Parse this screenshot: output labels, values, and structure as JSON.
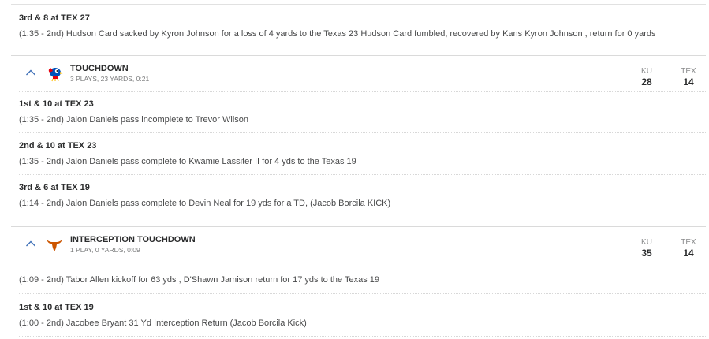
{
  "plays_prev": [
    {
      "down": "3rd & 8 at TEX 27",
      "desc": "(1:35 - 2nd) Hudson Card sacked by Kyron Johnson for a loss of 4 yards to the Texas 23 Hudson Card fumbled, recovered by Kans Kyron Johnson , return for 0 yards"
    }
  ],
  "drives": [
    {
      "title": "TOUCHDOWN",
      "summary": "3 PLAYS, 23 YARDS, 0:21",
      "team_logo": "kansas-jayhawk-logo",
      "home_abbr": "KU",
      "away_abbr": "TEX",
      "home_score": "28",
      "away_score": "14",
      "plays": [
        {
          "down": "1st & 10 at TEX 23",
          "desc": "(1:35 - 2nd) Jalon Daniels pass incomplete to Trevor Wilson"
        },
        {
          "down": "2nd & 10 at TEX 23",
          "desc": "(1:35 - 2nd) Jalon Daniels pass complete to Kwamie Lassiter II for 4 yds to the Texas 19"
        },
        {
          "down": "3rd & 6 at TEX 19",
          "desc": "(1:14 - 2nd) Jalon Daniels pass complete to Devin Neal for 19 yds for a TD, (Jacob Borcila KICK)"
        }
      ]
    },
    {
      "title": "INTERCEPTION TOUCHDOWN",
      "summary": "1 PLAY, 0 YARDS, 0:09",
      "team_logo": "texas-longhorn-logo",
      "home_abbr": "KU",
      "away_abbr": "TEX",
      "home_score": "35",
      "away_score": "14",
      "plays": [
        {
          "down": "",
          "desc": "(1:09 - 2nd) Tabor Allen kickoff for 63 yds , D'Shawn Jamison return for 17 yds to the Texas 19"
        },
        {
          "down": "1st & 10 at TEX 19",
          "desc": "(1:00 - 2nd) Jacobee Bryant 31 Yd Interception Return (Jacob Borcila Kick)"
        }
      ]
    }
  ],
  "colors": {
    "chevron": "#3d6fb6",
    "kansas_blue": "#0051ba",
    "kansas_red": "#e8000d",
    "kansas_yellow": "#ffc82d",
    "texas_orange": "#cc5500"
  }
}
